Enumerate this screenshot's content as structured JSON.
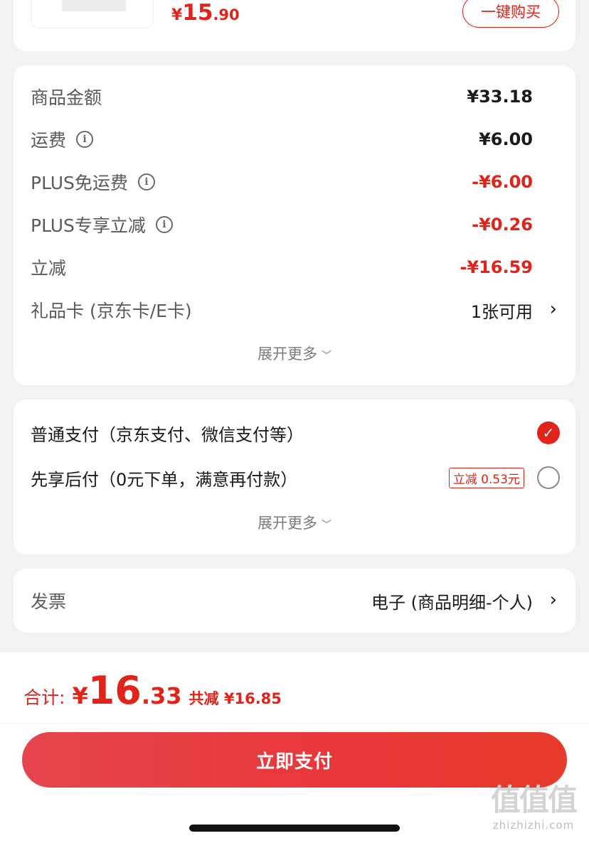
{
  "product": {
    "price_yen": "¥",
    "price_int": "15",
    "price_dec": ".90",
    "buy_label": "一键购买"
  },
  "summary": {
    "rows": [
      {
        "label": "商品金额",
        "value": "¥33.18"
      },
      {
        "label": "运费",
        "value": "¥6.00"
      },
      {
        "label": "PLUS免运费",
        "value": "-¥6.00"
      },
      {
        "label": "PLUS专享立减",
        "value": "-¥0.26"
      },
      {
        "label": "立减",
        "value": "-¥16.59"
      },
      {
        "label": "礼品卡 (京东卡/E卡)",
        "value": "1张可用"
      }
    ],
    "expand_label": "展开更多"
  },
  "payment": {
    "options": [
      {
        "label": "普通支付（京东支付、微信支付等）",
        "selected": true
      },
      {
        "label": "先享后付（0元下单，满意再付款）",
        "selected": false,
        "tag": "立减 0.53元"
      }
    ],
    "expand_label": "展开更多"
  },
  "invoice": {
    "label": "发票",
    "value": "电子 (商品明细-个人)"
  },
  "footer": {
    "total_label": "合计:",
    "total_yen": "¥",
    "total_int": "16",
    "total_dec": ".33",
    "saved_label": "共减 ¥16.85",
    "pay_button": "立即支付"
  },
  "watermark": {
    "logo": "值值值",
    "url": "zhizhizhi.com"
  },
  "colors": {
    "accent": "#e2231a",
    "background": "#f2f2f2"
  },
  "icons": [
    "info-icon",
    "chevron-right-icon",
    "chevron-down-icon",
    "check-icon"
  ]
}
